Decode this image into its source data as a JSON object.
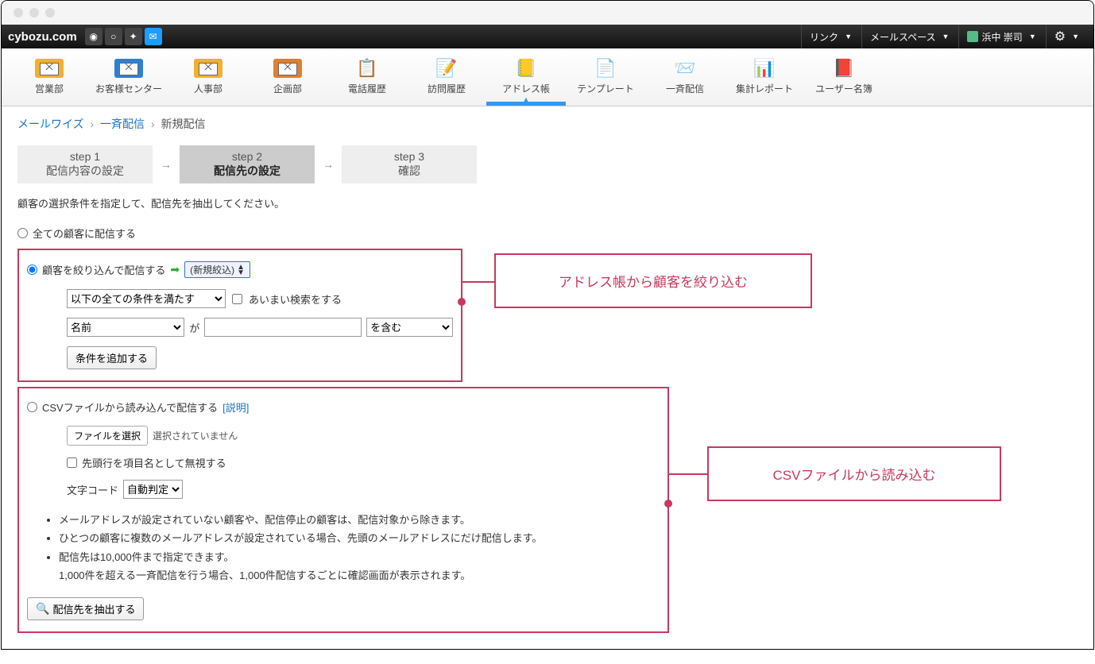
{
  "topbar": {
    "logo": "cybozu.com",
    "link_menu": "リンク",
    "mailspace_menu": "メールスペース",
    "username": "浜中 崇司"
  },
  "toolbar": [
    {
      "label": "営業部"
    },
    {
      "label": "お客様センター"
    },
    {
      "label": "人事部"
    },
    {
      "label": "企画部"
    },
    {
      "label": "電話履歴"
    },
    {
      "label": "訪問履歴"
    },
    {
      "label": "アドレス帳"
    },
    {
      "label": "テンプレート"
    },
    {
      "label": "一斉配信"
    },
    {
      "label": "集計レポート"
    },
    {
      "label": "ユーザー名簿"
    }
  ],
  "breadcrumb": {
    "items": [
      "メールワイズ",
      "一斉配信"
    ],
    "current": "新規配信"
  },
  "steps": [
    {
      "num": "step 1",
      "label": "配信内容の設定"
    },
    {
      "num": "step 2",
      "label": "配信先の設定"
    },
    {
      "num": "step 3",
      "label": "確認"
    }
  ],
  "instruction": "顧客の選択条件を指定して、配信先を抽出してください。",
  "radio_all": "全ての顧客に配信する",
  "radio_filter": "顧客を絞り込んで配信する",
  "new_filter_btn": "(新規絞込)",
  "condition_select": "以下の全ての条件を満たす",
  "fuzzy_label": "あいまい検索をする",
  "field_select": "名前",
  "ga": "が",
  "contains_select": "を含む",
  "add_condition_btn": "条件を追加する",
  "radio_csv": "CSVファイルから読み込んで配信する",
  "csv_help": "[説明]",
  "file_choose": "ファイルを選択",
  "file_status": "選択されていません",
  "skip_header": "先頭行を項目名として無視する",
  "charset_label": "文字コード",
  "charset_select": "自動判定",
  "notes": [
    "メールアドレスが設定されていない顧客や、配信停止の顧客は、配信対象から除きます。",
    "ひとつの顧客に複数のメールアドレスが設定されている場合、先頭のメールアドレスにだけ配信します。",
    "配信先は10,000件まで指定できます。",
    "1,000件を超える一斉配信を行う場合、1,000件配信するごとに確認画面が表示されます。"
  ],
  "extract_btn": "配信先を抽出する",
  "callout1": "アドレス帳から顧客を絞り込む",
  "callout2": "CSVファイルから読み込む"
}
